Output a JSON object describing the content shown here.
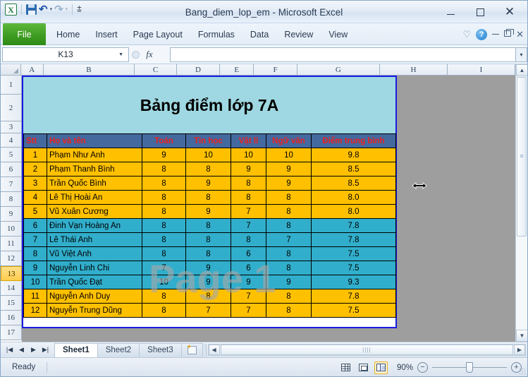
{
  "window": {
    "title": "Bang_diem_lop_em  -  Microsoft Excel",
    "minimize_label": "—",
    "maximize_label": "□",
    "close_label": "✕"
  },
  "quick_access": {
    "logo_label": "X",
    "save_icon": "save-icon",
    "undo_icon": "undo-icon",
    "undo_caret": "▾",
    "redo_icon": "redo-icon",
    "redo_caret": "▾",
    "customize_icon": "▾"
  },
  "ribbon": {
    "file_tab": "File",
    "tabs": [
      "Home",
      "Insert",
      "Page Layout",
      "Formulas",
      "Data",
      "Review",
      "View"
    ],
    "help_label": "?",
    "heart_label": "♡",
    "minimize_ribbon": "—",
    "restore_window": "restore-icon",
    "close_window": "✕"
  },
  "formula_bar": {
    "name_box_value": "K13",
    "name_box_caret": "▼",
    "fx_label": "fx",
    "formula_value": "",
    "expand_caret": "▾"
  },
  "grid": {
    "column_headers": [
      "A",
      "B",
      "C",
      "D",
      "E",
      "F",
      "G",
      "H",
      "I"
    ],
    "row_headers": [
      "1",
      "2",
      "3",
      "4",
      "5",
      "6",
      "7",
      "8",
      "9",
      "10",
      "11",
      "12",
      "13",
      "14",
      "15",
      "16",
      "17"
    ],
    "active_row": "13",
    "watermark": "Page 1",
    "sheet_title": "Bảng điểm lớp 7A"
  },
  "table": {
    "headers": [
      "Stt",
      "Họ và tên",
      "Toán",
      "Tin học",
      "Vật lí",
      "Ngữ văn",
      "Điểm trung bình"
    ],
    "rows": [
      {
        "stt": "1",
        "name": "Phạm Như Anh",
        "toan": "9",
        "tin": "10",
        "vatli": "10",
        "nguvan": "10",
        "tb": "9.8",
        "fill": "yellow"
      },
      {
        "stt": "2",
        "name": "Phạm Thanh Bình",
        "toan": "8",
        "tin": "8",
        "vatli": "9",
        "nguvan": "9",
        "tb": "8.5",
        "fill": "yellow"
      },
      {
        "stt": "3",
        "name": "Trần Quốc Bình",
        "toan": "8",
        "tin": "9",
        "vatli": "8",
        "nguvan": "9",
        "tb": "8.5",
        "fill": "yellow"
      },
      {
        "stt": "4",
        "name": "Lê Thị Hoài An",
        "toan": "8",
        "tin": "8",
        "vatli": "8",
        "nguvan": "8",
        "tb": "8.0",
        "fill": "yellow"
      },
      {
        "stt": "5",
        "name": "Vũ Xuân Cương",
        "toan": "8",
        "tin": "9",
        "vatli": "7",
        "nguvan": "8",
        "tb": "8.0",
        "fill": "yellow"
      },
      {
        "stt": "6",
        "name": "Đinh Vạn Hoàng An",
        "toan": "8",
        "tin": "8",
        "vatli": "7",
        "nguvan": "8",
        "tb": "7.8",
        "fill": "cyan"
      },
      {
        "stt": "7",
        "name": "Lê Thái Anh",
        "toan": "8",
        "tin": "8",
        "vatli": "8",
        "nguvan": "7",
        "tb": "7.8",
        "fill": "cyan"
      },
      {
        "stt": "8",
        "name": "Vũ Việt Anh",
        "toan": "8",
        "tin": "8",
        "vatli": "6",
        "nguvan": "8",
        "tb": "7.5",
        "fill": "cyan"
      },
      {
        "stt": "9",
        "name": "Nguyễn Linh Chi",
        "toan": "7",
        "tin": "9",
        "vatli": "6",
        "nguvan": "8",
        "tb": "7.5",
        "fill": "cyan"
      },
      {
        "stt": "10",
        "name": "Trần Quốc Đạt",
        "toan": "10",
        "tin": "9",
        "vatli": "9",
        "nguvan": "9",
        "tb": "9.3",
        "fill": "cyan"
      },
      {
        "stt": "11",
        "name": "Nguyễn Anh Duy",
        "toan": "8",
        "tin": "8",
        "vatli": "7",
        "nguvan": "8",
        "tb": "7.8",
        "fill": "yellow"
      },
      {
        "stt": "12",
        "name": "Nguyễn Trung Dũng",
        "toan": "8",
        "tin": "7",
        "vatli": "7",
        "nguvan": "8",
        "tb": "7.5",
        "fill": "yellow"
      }
    ]
  },
  "sheet_tabs": {
    "nav_first": "◀◀",
    "nav_prev": "◀",
    "nav_next": "▶",
    "nav_last": "▶▶",
    "tabs": [
      "Sheet1",
      "Sheet2",
      "Sheet3"
    ],
    "active": "Sheet1",
    "new_sheet_icon": "new-sheet-icon"
  },
  "scrollbars": {
    "h_left_arrow": "◀",
    "h_right_arrow": "▶",
    "h_grip": "||||",
    "v_up_arrow": "▲",
    "v_down_arrow": "▼",
    "v_grip": "≡"
  },
  "status_bar": {
    "state": "Ready",
    "view_normal": "normal-view-icon",
    "view_page_layout": "page-layout-view-icon",
    "view_page_break": "page-break-preview-icon",
    "zoom_level": "90%",
    "zoom_out": "−",
    "zoom_in": "+"
  },
  "colors": {
    "title_fill": "#9fd8e2",
    "header_fill": "#44699f",
    "header_text": "#e8211f",
    "row_yellow": "#ffc000",
    "row_cyan": "#31aecb",
    "print_border": "#1a1ae0",
    "file_tab_green": "#3f9c22"
  }
}
